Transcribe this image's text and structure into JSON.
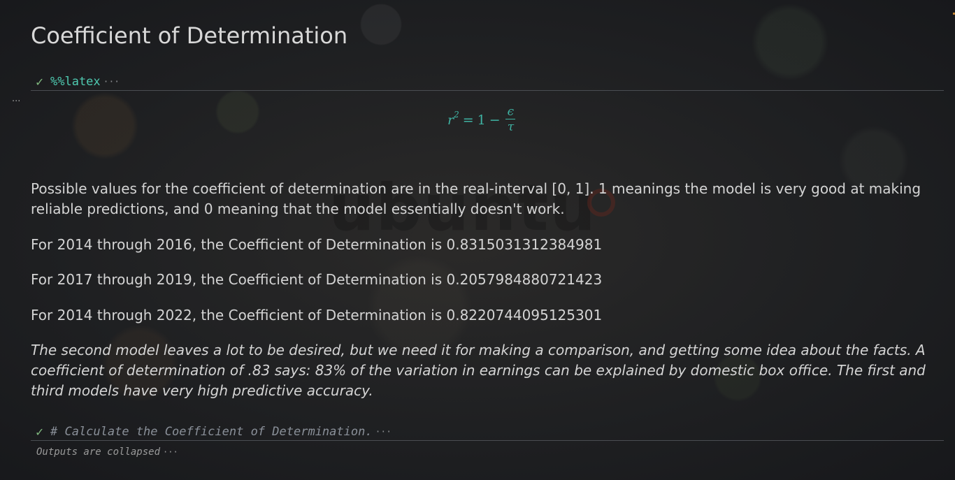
{
  "page": {
    "title": "Coefficient of Determination"
  },
  "latex_cell": {
    "code": "%%latex",
    "status_icon": "check-icon",
    "more": "···",
    "side_menu": "···",
    "formula": {
      "lhs": "r",
      "lhs_sup": "2",
      "equals": "=",
      "one": "1",
      "minus": "−",
      "numerator": "ϵ",
      "denominator": "τ"
    }
  },
  "markdown": {
    "intro": "Possible values for the coefficient of determination are in the real-interval [0, 1]. 1 meanings the model is very good at making reliable predictions, and 0 meaning that the model essentially doesn't work.",
    "results": [
      "For 2014 through 2016, the Coefficient of Determination is 0.8315031312384981",
      "For 2017 through 2019, the Coefficient of Determination is 0.2057984880721423",
      "For 2014 through 2022, the Coefficient of Determination is 0.8220744095125301"
    ],
    "commentary": "The second model leaves a lot to be desired, but we need it for making a comparison, and getting some idea about the facts. A coefficient of determination of .83 says: 83% of the variation in earnings can be explained by domestic box office. The first and third models have very high predictive accuracy."
  },
  "code_cell": {
    "code": "# Calculate the Coefficient of Determination.",
    "status_icon": "check-icon",
    "more": "···",
    "outputs_note": "Outputs are collapsed",
    "outputs_more": "···"
  },
  "background": {
    "watermark_text": "ubuntu",
    "colors": {
      "background": "#1c1e21",
      "accent_math": "#3fb3a3",
      "code_keyword": "#4ec9b0",
      "success_check": "#7fb77e"
    }
  }
}
